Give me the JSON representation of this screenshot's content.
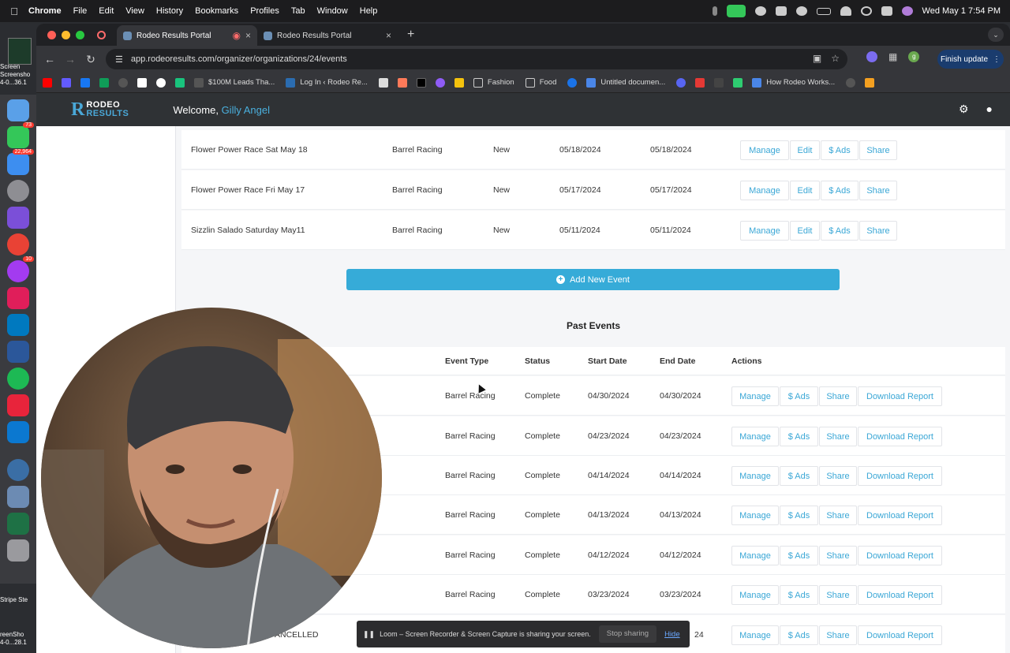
{
  "menubar": {
    "apple": "",
    "items": [
      "Chrome",
      "File",
      "Edit",
      "View",
      "History",
      "Bookmarks",
      "Profiles",
      "Tab",
      "Window",
      "Help"
    ],
    "clock": "Wed May 1  7:54 PM"
  },
  "dock": {
    "messages_badge": "73",
    "mail_badge": "22,964",
    "messenger_badge": "10",
    "desktop_labels": [
      "Screen",
      "Screensho",
      "4-0...36.1",
      "Stripe Ste",
      "reenSho",
      "4-0...28.1"
    ]
  },
  "browser": {
    "tabs": [
      {
        "title": "Rodeo Results Portal",
        "active": true
      },
      {
        "title": "Rodeo Results Portal",
        "active": false
      }
    ],
    "new_tab": "+",
    "url": "app.rodeoresults.com/organizer/organizations/24/events",
    "profile_initial": "g",
    "finish_update": "Finish update",
    "bookmarks": [
      {
        "label": "$100M Leads Tha...",
        "color": "#555"
      },
      {
        "label": "Log In ‹ Rodeo Re...",
        "color": "#2b6cb0"
      },
      {
        "label": "Fashion",
        "color": "folder"
      },
      {
        "label": "Food",
        "color": "folder"
      },
      {
        "label": "Untitled documen...",
        "color": "#4a86e8"
      },
      {
        "label": "How Rodeo Works...",
        "color": "#4a86e8"
      }
    ]
  },
  "app": {
    "logo_letter": "R",
    "logo_top": "RODEO",
    "logo_bottom": "RESULTS",
    "welcome_prefix": "Welcome,",
    "user_name": "Gilly Angel",
    "upcoming_rows": [
      {
        "name": "Flower Power Race Sat May 18",
        "type": "Barrel Racing",
        "status": "New",
        "start": "05/18/2024",
        "end": "05/18/2024"
      },
      {
        "name": "Flower Power Race Fri May 17",
        "type": "Barrel Racing",
        "status": "New",
        "start": "05/17/2024",
        "end": "05/17/2024"
      },
      {
        "name": "Sizzlin Salado Saturday May11",
        "type": "Barrel Racing",
        "status": "New",
        "start": "05/11/2024",
        "end": "05/11/2024"
      }
    ],
    "upcoming_actions": [
      "Manage",
      "Edit",
      "$ Ads",
      "Share"
    ],
    "add_event_label": "Add New Event",
    "past_title": "Past Events",
    "past_headers": {
      "type": "Event Type",
      "status": "Status",
      "start": "Start Date",
      "end": "End Date",
      "actions": "Actions"
    },
    "past_rows": [
      {
        "name": "",
        "type": "Barrel Racing",
        "status": "Complete",
        "start": "04/30/2024",
        "end": "04/30/2024"
      },
      {
        "name": "",
        "type": "Barrel Racing",
        "status": "Complete",
        "start": "04/23/2024",
        "end": "04/23/2024"
      },
      {
        "name": "",
        "type": "Barrel Racing",
        "status": "Complete",
        "start": "04/14/2024",
        "end": "04/14/2024"
      },
      {
        "name": "",
        "type": "Barrel Racing",
        "status": "Complete",
        "start": "04/13/2024",
        "end": "04/13/2024"
      },
      {
        "name": "",
        "type": "Barrel Racing",
        "status": "Complete",
        "start": "04/12/2024",
        "end": "04/12/2024"
      },
      {
        "name": "",
        "type": "Barrel Racing",
        "status": "Complete",
        "start": "03/23/2024",
        "end": "03/23/2024"
      },
      {
        "name": "ANCELLED",
        "type": "",
        "status": "",
        "start": "",
        "end": "24"
      }
    ],
    "past_actions": [
      "Manage",
      "$ Ads",
      "Share",
      "Download Report"
    ]
  },
  "loom": {
    "message": "Loom – Screen Recorder & Screen Capture is sharing your screen.",
    "stop": "Stop sharing",
    "hide": "Hide"
  },
  "colors": {
    "accent": "#36abd8",
    "link": "#3aa7d6",
    "nav_bg": "#2f3235"
  }
}
